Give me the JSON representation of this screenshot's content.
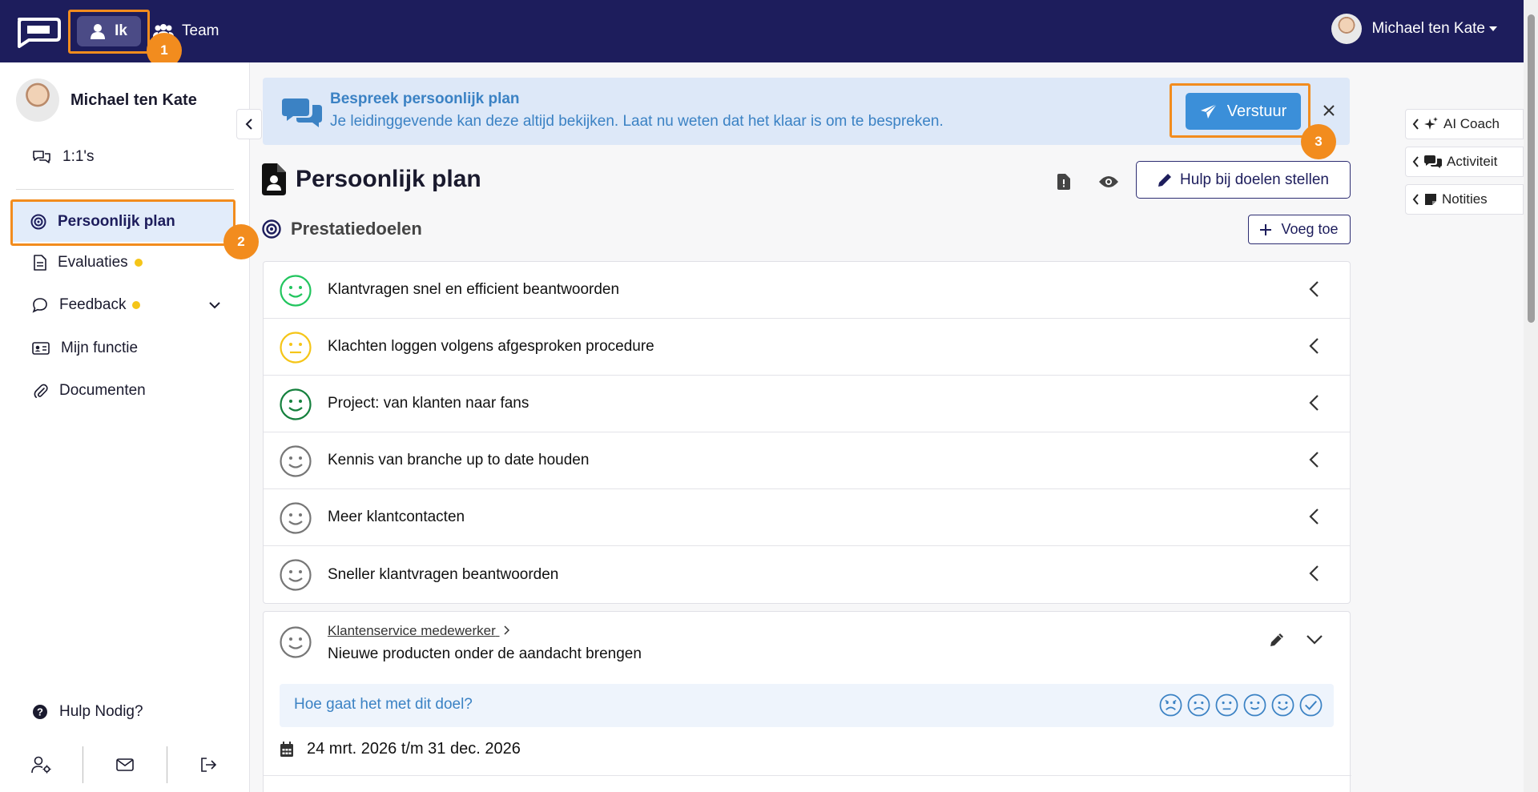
{
  "topbar": {
    "nav_me": "Ik",
    "nav_team": "Team",
    "user_name": "Michael ten Kate"
  },
  "annotations": {
    "badge1": "1",
    "badge2": "2",
    "badge3": "3"
  },
  "sidebar": {
    "user_name": "Michael ten Kate",
    "items": [
      {
        "label": "1:1's"
      },
      {
        "label": "Persoonlijk plan"
      },
      {
        "label": "Evaluaties"
      },
      {
        "label": "Feedback"
      },
      {
        "label": "Mijn functie"
      },
      {
        "label": "Documenten"
      }
    ],
    "help": "Hulp Nodig?"
  },
  "banner": {
    "title": "Bespreek persoonlijk plan",
    "text": "Je leidinggevende kan deze altijd bekijken. Laat nu weten dat het klaar is om te bespreken.",
    "send_label": "Verstuur"
  },
  "page": {
    "title": "Persoonlijk plan",
    "help_button": "Hulp bij doelen stellen",
    "section_title": "Prestatiedoelen",
    "add_button": "Voeg toe"
  },
  "goals": [
    {
      "title": "Klantvragen snel en efficient beantwoorden",
      "mood": "happy",
      "color": "#22c55e"
    },
    {
      "title": "Klachten loggen volgens afgesproken procedure",
      "mood": "neutral",
      "color": "#f5c518"
    },
    {
      "title": "Project: van klanten naar fans",
      "mood": "happy",
      "color": "#15803d"
    },
    {
      "title": "Kennis van branche up to date houden",
      "mood": "none",
      "color": "#777777"
    },
    {
      "title": "Meer klantcontacten",
      "mood": "none",
      "color": "#777777"
    },
    {
      "title": "Sneller klantvragen beantwoorden",
      "mood": "none",
      "color": "#777777"
    }
  ],
  "expanded_goal": {
    "role_link": "Klantenservice medewerker",
    "title": "Nieuwe producten onder de aandacht brengen",
    "question": "Hoe gaat het met dit doel?",
    "date_range": "24 mrt. 2026 t/m 31 dec. 2026"
  },
  "right_panel": {
    "tabs": [
      {
        "label": "AI Coach"
      },
      {
        "label": "Activiteit"
      },
      {
        "label": "Notities"
      }
    ]
  },
  "colors": {
    "topbar": "#1d1d5c",
    "accent": "#3b8fd9",
    "highlight": "#f28c1e",
    "banner_bg": "#dde8f8",
    "active_item_bg": "#e2ecfa"
  }
}
